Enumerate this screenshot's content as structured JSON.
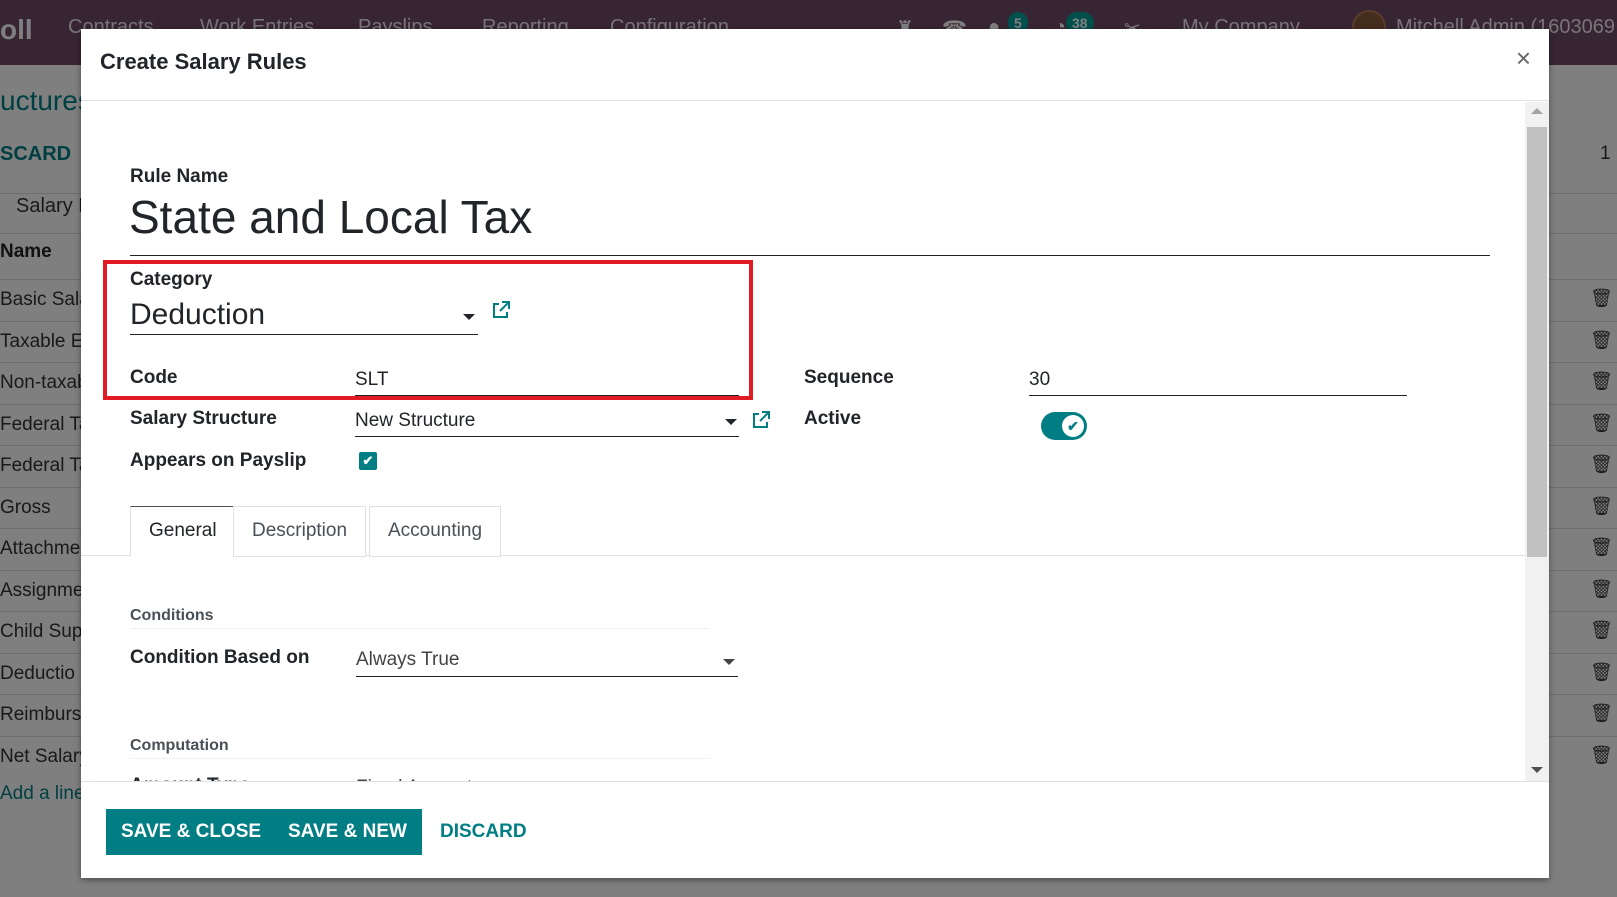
{
  "topbar": {
    "app_name": "oll",
    "menus": [
      "Contracts",
      "Work Entries",
      "Payslips",
      "Reporting",
      "Configuration"
    ],
    "messages_badge": "5",
    "activities_badge": "38",
    "company": "My Company",
    "user": "Mitchell Admin (1603069"
  },
  "background": {
    "title": "uctures",
    "discard": "SCARD",
    "pager": "1",
    "tab": "Salary R",
    "column_name": "Name",
    "rows": [
      "Basic Sala",
      "Taxable E",
      "Non-taxab",
      "Federal Ta",
      "Federal Ta",
      "Gross",
      "Attachme",
      "Assignme",
      "Child Sup",
      "Deductio",
      "Reimburs",
      "Net Salary"
    ],
    "add_line": "Add a line",
    "trash_icon": "🗑"
  },
  "modal": {
    "title": "Create Salary Rules",
    "close": "×",
    "rule_name_label": "Rule Name",
    "rule_name": "State and Local Tax",
    "category_label": "Category",
    "category": "Deduction",
    "code_label": "Code",
    "code": "SLT",
    "sequence_label": "Sequence",
    "sequence": "30",
    "salary_structure_label": "Salary Structure",
    "salary_structure": "New Structure",
    "active_label": "Active",
    "active": true,
    "appears_on_payslip_label": "Appears on Payslip",
    "appears_on_payslip": true,
    "check_glyph": "✔",
    "tabs": [
      {
        "label": "General",
        "active": true
      },
      {
        "label": "Description",
        "active": false
      },
      {
        "label": "Accounting",
        "active": false
      }
    ],
    "conditions_title": "Conditions",
    "condition_based_on_label": "Condition Based on",
    "condition_based_on": "Always True",
    "computation_title": "Computation",
    "amount_type_label": "Amount Type",
    "amount_type": "Fixed Amount"
  },
  "footer": {
    "save_close": "SAVE & CLOSE",
    "save_new": "SAVE & NEW",
    "discard": "DISCARD"
  },
  "colors": {
    "brand": "#714b67",
    "accent": "#017e84",
    "highlight": "#e01b24"
  }
}
